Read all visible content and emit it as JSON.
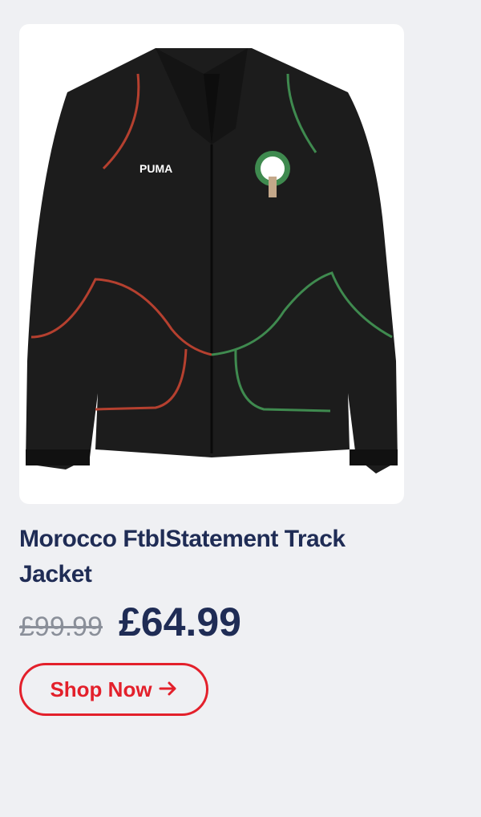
{
  "product": {
    "image_alt": "Morocco FtblStatement Track Jacket",
    "brand_logo_text": "PUMA",
    "title": "Morocco FtblStatement Track Jacket",
    "original_price": "£99.99",
    "sale_price": "£64.99",
    "cta_label": "Shop Now",
    "cta_icon": "arrow-right-icon",
    "colors": {
      "title": "#1f2c55",
      "accent": "#e3202b",
      "strikethrough": "#8a8f99",
      "jacket": "#1c1c1c",
      "piping_red": "#b5402f",
      "piping_green": "#3f8a4f"
    }
  }
}
